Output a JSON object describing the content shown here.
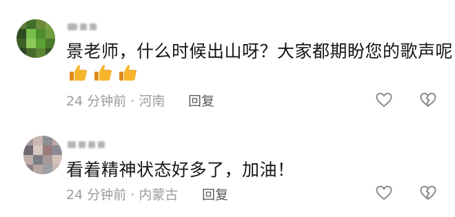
{
  "comments": [
    {
      "text": "景老师，什么时候出山呀？大家都期盼您的歌声呢",
      "time": "24 分钟前",
      "location": "河南",
      "reply_label": "回复",
      "emojis": [
        "thumbs-up",
        "thumbs-up",
        "thumbs-up"
      ]
    },
    {
      "text": "看着精神状态好多了，加油！",
      "time": "24 分钟前",
      "location": "内蒙古",
      "reply_label": "回复"
    }
  ],
  "separator": " · ",
  "colors": {
    "text": "#161616",
    "meta": "#9a9a9a",
    "reply": "#5a5a5a",
    "icon": "#8a8a8a",
    "thumb": "#f7b52c"
  }
}
